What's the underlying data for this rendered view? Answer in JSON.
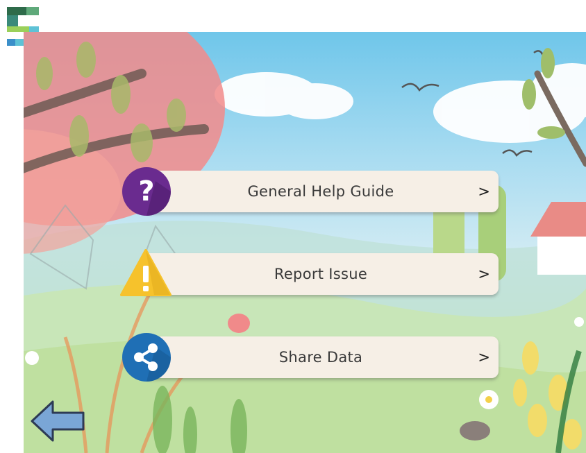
{
  "menu": {
    "items": [
      {
        "id": "help",
        "label": "General Help Guide",
        "chevron": ">",
        "icon": "question-icon",
        "icon_color": "#6a2b8f"
      },
      {
        "id": "report",
        "label": "Report Issue",
        "chevron": ">",
        "icon": "warning-icon",
        "icon_color": "#f6c22c"
      },
      {
        "id": "share",
        "label": "Share Data",
        "chevron": ">",
        "icon": "share-icon",
        "icon_color": "#1f6fb5"
      }
    ]
  },
  "navigation": {
    "back_icon": "back-arrow-icon",
    "back_color": "#7aa6d6"
  },
  "brand": {
    "logo_icon": "app-logo-icon",
    "colors": [
      "#3a7d44",
      "#5ec2d6",
      "#9ad05a"
    ]
  },
  "theme": {
    "button_bg": "#f6efe6",
    "text_color": "#3a3a3a"
  }
}
